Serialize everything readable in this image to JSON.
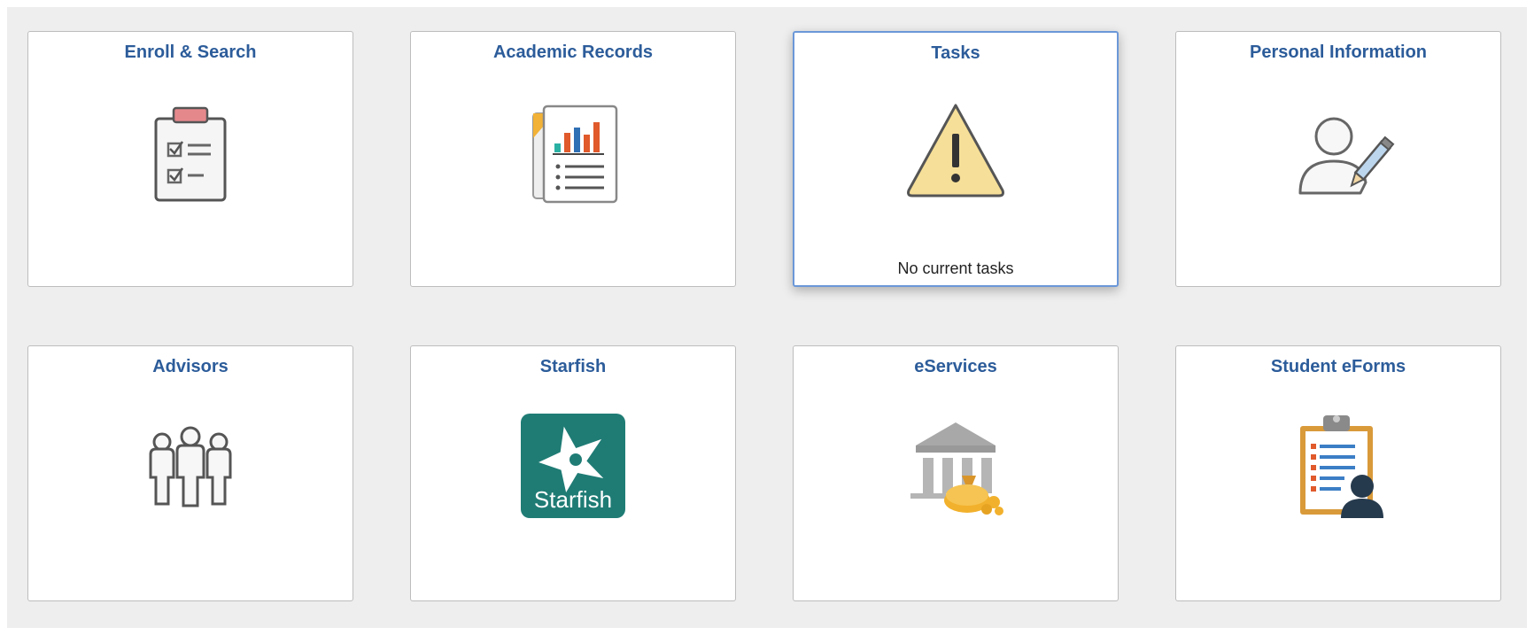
{
  "tiles": [
    {
      "title": "Enroll & Search",
      "icon": "clipboard-checklist-icon"
    },
    {
      "title": "Academic Records",
      "icon": "report-chart-icon"
    },
    {
      "title": "Tasks",
      "icon": "warning-icon",
      "status": "No current tasks"
    },
    {
      "title": "Personal Information",
      "icon": "user-edit-icon"
    },
    {
      "title": "Advisors",
      "icon": "people-group-icon"
    },
    {
      "title": "Starfish",
      "icon": "starfish-logo-icon",
      "logo_text": "Starfish"
    },
    {
      "title": "eServices",
      "icon": "bank-coins-icon"
    },
    {
      "title": "Student eForms",
      "icon": "clipboard-student-icon"
    }
  ],
  "colors": {
    "title_blue": "#2c5c9a",
    "focus_border": "#6b97d8",
    "starfish_teal": "#1f7c75",
    "warning_yellow": "#f6df98"
  }
}
